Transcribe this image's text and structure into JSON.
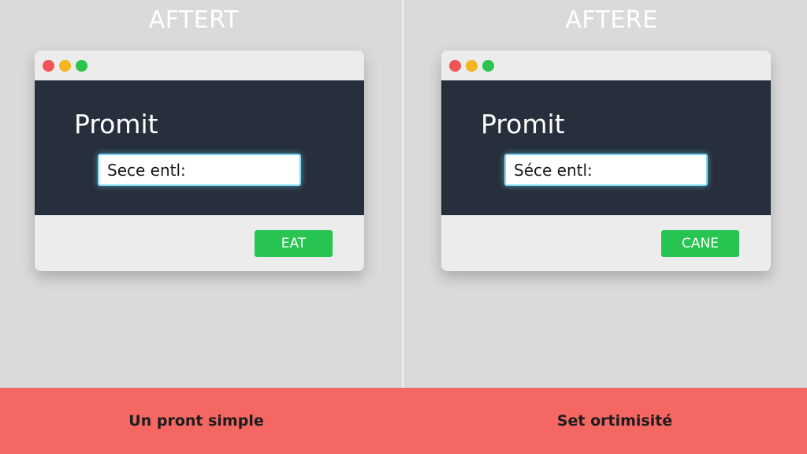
{
  "colors": {
    "background": "#dadada",
    "window_body": "#262f3b",
    "button": "#27c451",
    "bottom_bar": "#f46762",
    "input_glow": "#7fd8f4"
  },
  "left_panel": {
    "heading": "AFTERT",
    "window": {
      "traffic_lights": [
        "red",
        "yellow",
        "green"
      ],
      "title": "Promit",
      "input_value": "Sece entl:",
      "button_label": "EAT"
    },
    "caption": "Un pront simple"
  },
  "right_panel": {
    "heading": "AFTERE",
    "window": {
      "traffic_lights": [
        "red",
        "yellow",
        "green"
      ],
      "title": "Promit",
      "input_value": "Séce entl:",
      "button_label": "CANE"
    },
    "caption": "Set ortimisité"
  }
}
